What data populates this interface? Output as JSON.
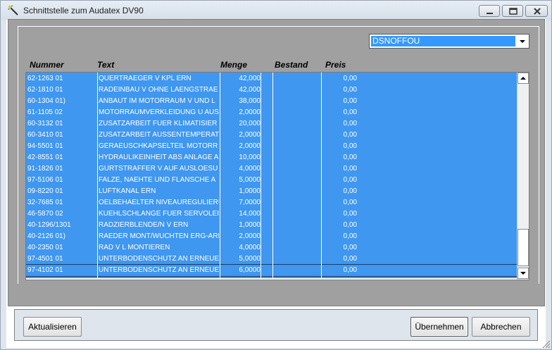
{
  "window": {
    "title": "Schnittstelle zum Audatex DV90"
  },
  "dropdown": {
    "selected": "DSNOFFOU"
  },
  "columns": [
    "Nummer",
    "Text",
    "Menge",
    "Bestand",
    "Preis"
  ],
  "rows": [
    {
      "nummer": "62-1263 01",
      "text": "QUERTRAEGER V KPL ERN",
      "menge": "42,000",
      "bestand": "",
      "preis": "0,00"
    },
    {
      "nummer": "62-1810 01",
      "text": "RADEINBAU V OHNE LAENGSTRAE",
      "menge": "42,000",
      "bestand": "",
      "preis": "0,00"
    },
    {
      "nummer": "60-1304 01)",
      "text": "ANBAUT IM MOTORRAUM V UND L",
      "menge": "38,000",
      "bestand": "",
      "preis": "0,00"
    },
    {
      "nummer": "61-1105 02",
      "text": "MOTORRAUMVERKLEIDUNG U AUS",
      "menge": "2,0000",
      "bestand": "",
      "preis": "0,00"
    },
    {
      "nummer": "60-3132 01",
      "text": "ZUSATZARBEIT FUER KLIMATISIER",
      "menge": "20,000",
      "bestand": "",
      "preis": "0,00"
    },
    {
      "nummer": "60-3410 01",
      "text": "ZUSATZARBEIT AUSSENTEMPERAT",
      "menge": "2,0000",
      "bestand": "",
      "preis": "0,00"
    },
    {
      "nummer": "94-5501 01",
      "text": "GERAEUSCHKAPSELTEIL MOTORR",
      "menge": "2,0000",
      "bestand": "",
      "preis": "0,00"
    },
    {
      "nummer": "42-8551 01",
      "text": "HYDRAULIKEINHEIT ABS ANLAGE A",
      "menge": "10,000",
      "bestand": "",
      "preis": "0,00"
    },
    {
      "nummer": "91-1826 01",
      "text": "GURTSTRAFFER V AUF AUSLOESU",
      "menge": "4,0000",
      "bestand": "",
      "preis": "0,00"
    },
    {
      "nummer": "97-5106 01",
      "text": "FALZE, NAEHTE UND FLANSCHE A",
      "menge": "5,0000",
      "bestand": "",
      "preis": "0,00"
    },
    {
      "nummer": "09-8220 01",
      "text": "LUFTKANAL ERN",
      "menge": "1,0000",
      "bestand": "",
      "preis": "0,00"
    },
    {
      "nummer": "32-7685 01",
      "text": "OELBEHAELTER NIVEAUREGULIERU",
      "menge": "7,0000",
      "bestand": "",
      "preis": "0,00"
    },
    {
      "nummer": "46-5870 02",
      "text": "KUEHLSCHLANGE FUER SERVOLEI",
      "menge": "14,000",
      "bestand": "",
      "preis": "0,00"
    },
    {
      "nummer": "40-1296/1301",
      "text": "RADZIERBLENDE/N V ERN",
      "menge": "1,0000",
      "bestand": "",
      "preis": "0,00"
    },
    {
      "nummer": "40-2126 01)",
      "text": "RAEDER MONT/WUCHTEN ERG-ARE",
      "menge": "2,0000",
      "bestand": "",
      "preis": "0,00"
    },
    {
      "nummer": "40-2350 01",
      "text": "RAD V L MONTIEREN",
      "menge": "4,0000",
      "bestand": "",
      "preis": "0,00"
    },
    {
      "nummer": "97-4501 01",
      "text": "UNTERBODENSCHUTZ AN ERNEUEF",
      "menge": "5,0000",
      "bestand": "",
      "preis": "0,00"
    },
    {
      "nummer": "97-4102 01",
      "text": "UNTERBODENSCHUTZ AN ERNEUEF",
      "menge": "6,0000",
      "bestand": "",
      "preis": "0,00"
    }
  ],
  "buttons": {
    "refresh": "Aktualisieren",
    "apply": "Übernehmen",
    "cancel": "Abbrechen"
  },
  "colors": {
    "selection": "#3f97ef",
    "dropdown_selection": "#3399ff",
    "panel": "#a0a0a0"
  }
}
